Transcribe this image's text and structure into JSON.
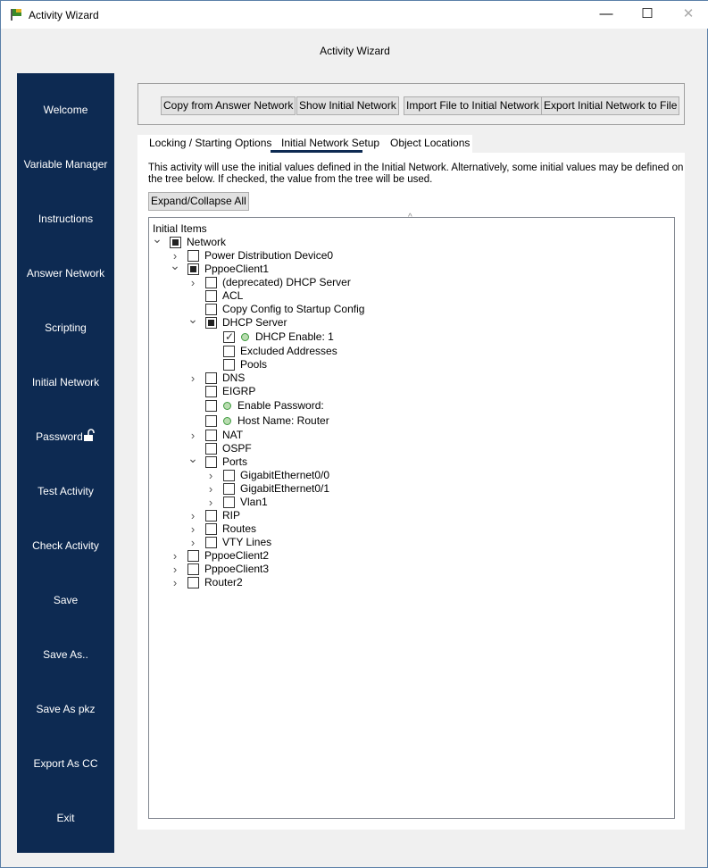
{
  "window": {
    "title": "Activity Wizard",
    "minimize": "—",
    "maximize": "☐",
    "close": "✕"
  },
  "header": {
    "title": "Activity Wizard"
  },
  "sidebar": {
    "items": [
      {
        "label": "Welcome"
      },
      {
        "label": "Variable Manager"
      },
      {
        "label": "Instructions"
      },
      {
        "label": "Answer Network"
      },
      {
        "label": "Scripting"
      },
      {
        "label": "Initial Network"
      },
      {
        "label": "Password",
        "icon": "unlock-icon"
      },
      {
        "label": "Test Activity"
      },
      {
        "label": "Check Activity"
      },
      {
        "label": "Save"
      },
      {
        "label": "Save As.."
      },
      {
        "label": "Save As pkz"
      },
      {
        "label": "Export As CC"
      },
      {
        "label": "Exit"
      }
    ],
    "color": "#0d2a52"
  },
  "toolbar": {
    "copy": "Copy from Answer Network",
    "show": "Show Initial Network",
    "import": "Import File to Initial Network",
    "export": "Export Initial Network to File"
  },
  "tabs": [
    {
      "label": "Locking / Starting Options"
    },
    {
      "label": "Initial Network Setup",
      "active": true
    },
    {
      "label": "Object Locations"
    }
  ],
  "content": {
    "description": "This activity will use the initial values defined in the Initial Network. Alternatively, some initial values may be defined on the tree below. If checked, the value from the tree will be used.",
    "expand_collapse": "Expand/Collapse All"
  },
  "tree": {
    "header": "Initial Items",
    "rows": [
      {
        "label": "Network",
        "level": 0,
        "exp": "open",
        "state": "partial"
      },
      {
        "label": "Power Distribution Device0",
        "level": 1,
        "exp": "closed",
        "state": "none"
      },
      {
        "label": "PppoeClient1",
        "level": 1,
        "exp": "open",
        "state": "partial"
      },
      {
        "label": "(deprecated) DHCP Server",
        "level": 2,
        "exp": "closed",
        "state": "none"
      },
      {
        "label": "ACL",
        "level": 2,
        "exp": "",
        "state": "none"
      },
      {
        "label": "Copy Config to Startup Config",
        "level": 2,
        "exp": "",
        "state": "none"
      },
      {
        "label": "DHCP Server",
        "level": 2,
        "exp": "open",
        "state": "partial"
      },
      {
        "label": "DHCP Enable: 1",
        "level": 3,
        "exp": "",
        "state": "checked",
        "dot": true
      },
      {
        "label": "Excluded Addresses",
        "level": 3,
        "exp": "",
        "state": "none"
      },
      {
        "label": "Pools",
        "level": 3,
        "exp": "",
        "state": "none"
      },
      {
        "label": "DNS",
        "level": 2,
        "exp": "closed",
        "state": "none"
      },
      {
        "label": "EIGRP",
        "level": 2,
        "exp": "",
        "state": "none"
      },
      {
        "label": "Enable Password:",
        "level": 2,
        "exp": "",
        "state": "none",
        "dot": true
      },
      {
        "label": "Host Name: Router",
        "level": 2,
        "exp": "",
        "state": "none",
        "dot": true
      },
      {
        "label": "NAT",
        "level": 2,
        "exp": "closed",
        "state": "none"
      },
      {
        "label": "OSPF",
        "level": 2,
        "exp": "",
        "state": "none"
      },
      {
        "label": "Ports",
        "level": 2,
        "exp": "open",
        "state": "none"
      },
      {
        "label": "GigabitEthernet0/0",
        "level": 3,
        "exp": "closed",
        "state": "none"
      },
      {
        "label": "GigabitEthernet0/1",
        "level": 3,
        "exp": "closed",
        "state": "none"
      },
      {
        "label": "Vlan1",
        "level": 3,
        "exp": "closed",
        "state": "none"
      },
      {
        "label": "RIP",
        "level": 2,
        "exp": "closed",
        "state": "none"
      },
      {
        "label": "Routes",
        "level": 2,
        "exp": "closed",
        "state": "none"
      },
      {
        "label": "VTY Lines",
        "level": 2,
        "exp": "closed",
        "state": "none"
      },
      {
        "label": "PppoeClient2",
        "level": 1,
        "exp": "closed",
        "state": "none"
      },
      {
        "label": "PppoeClient3",
        "level": 1,
        "exp": "closed",
        "state": "none"
      },
      {
        "label": "Router2",
        "level": 1,
        "exp": "closed",
        "state": "none"
      }
    ]
  }
}
